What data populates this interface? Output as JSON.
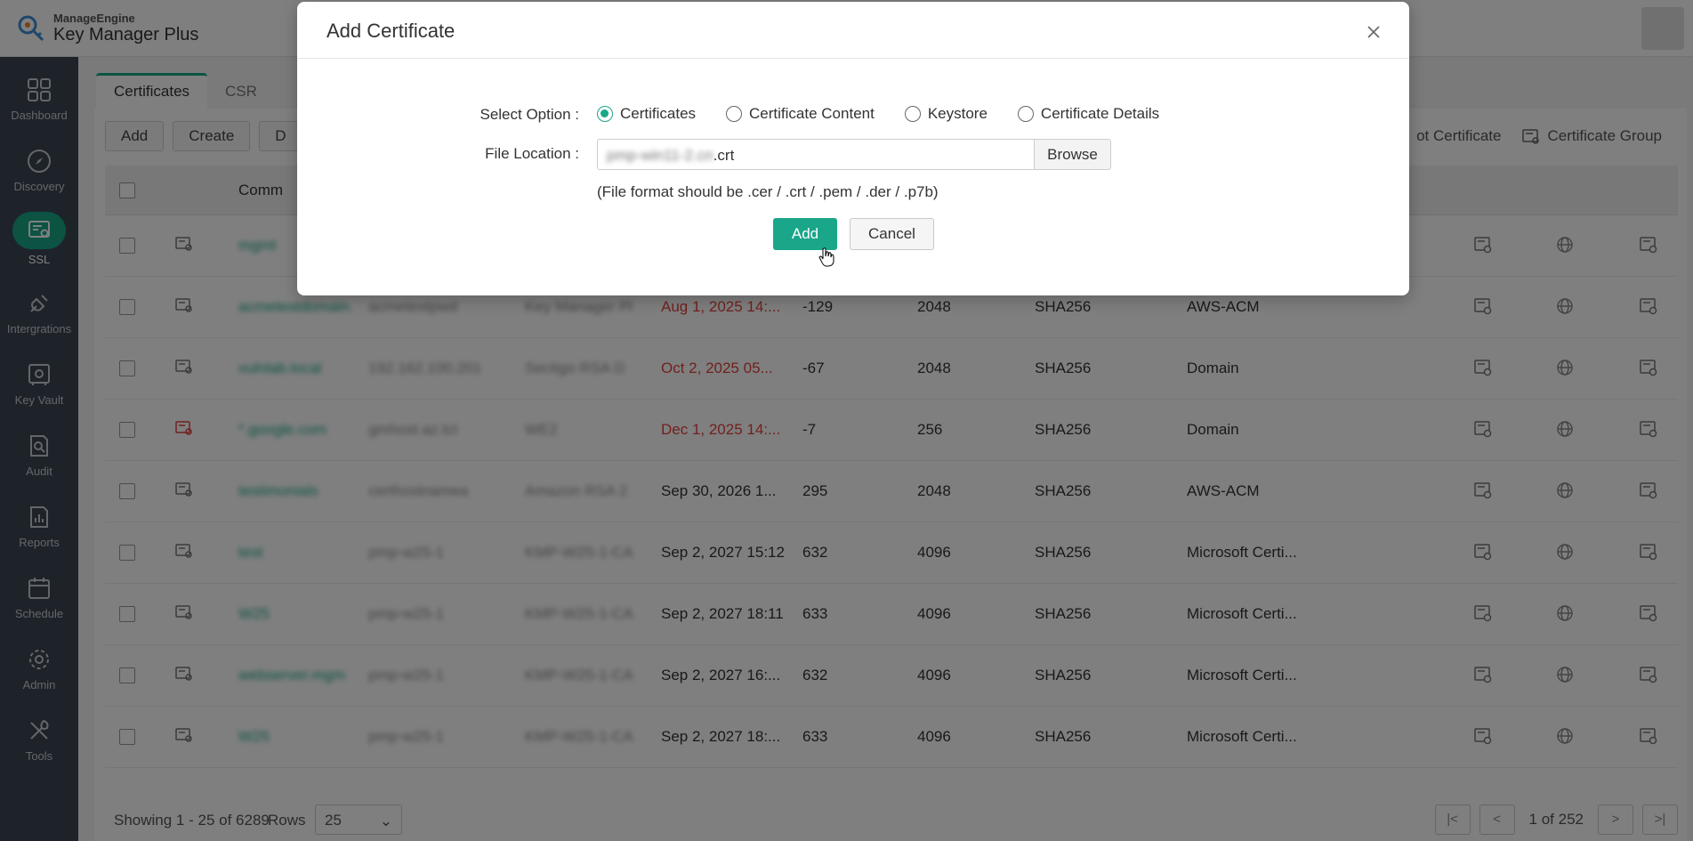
{
  "header": {
    "brand": "ManageEngine",
    "product": "Key Manager Plus"
  },
  "sidebar": {
    "items": [
      {
        "label": "Dashboard",
        "icon": "dashboard-icon"
      },
      {
        "label": "Discovery",
        "icon": "compass-icon"
      },
      {
        "label": "SSL",
        "icon": "certificate-icon",
        "active": true
      },
      {
        "label": "Intergrations",
        "icon": "plug-icon"
      },
      {
        "label": "Key Vault",
        "icon": "vault-icon"
      },
      {
        "label": "Audit",
        "icon": "audit-icon"
      },
      {
        "label": "Reports",
        "icon": "reports-icon"
      },
      {
        "label": "Schedule",
        "icon": "calendar-icon"
      },
      {
        "label": "Admin",
        "icon": "gear-icon"
      },
      {
        "label": "Tools",
        "icon": "tools-icon"
      }
    ]
  },
  "tabs": [
    "Certificates",
    "CSR"
  ],
  "toolbar": {
    "add": "Add",
    "create": "Create",
    "partial": "D",
    "root_certificate": "ot Certificate",
    "certificate_group": "Certificate Group"
  },
  "table": {
    "header_partial": "Comm",
    "rows": [
      {
        "name": "mgmt",
        "dns": "",
        "issuer": "",
        "expiry": "",
        "days": "",
        "key": "",
        "algo": "",
        "type": "",
        "expired": false
      },
      {
        "name": "acmetestdomain.",
        "dns": "acmetestpwd",
        "issuer": "Key Manager Pl",
        "expiry": "Aug 1, 2025 14:...",
        "days": "-129",
        "key": "2048",
        "algo": "SHA256",
        "type": "AWS-ACM",
        "expired": true
      },
      {
        "name": "vulnlab.local",
        "dns": "192.162.100.201",
        "issuer": "Sectigo RSA D",
        "expiry": "Oct 2, 2025 05...",
        "days": "-67",
        "key": "2048",
        "algo": "SHA256",
        "type": "Domain",
        "expired": true
      },
      {
        "name": "*.google.com",
        "dns": "gmhost.az.tcl",
        "issuer": "WE2",
        "expiry": "Dec 1, 2025 14:...",
        "days": "-7",
        "key": "256",
        "algo": "SHA256",
        "type": "Domain",
        "expired": true
      },
      {
        "name": "testimonials",
        "dns": "certhostnamea",
        "issuer": "Amazon RSA 2",
        "expiry": "Sep 30, 2026 1...",
        "days": "295",
        "key": "2048",
        "algo": "SHA256",
        "type": "AWS-ACM",
        "expired": false
      },
      {
        "name": "test",
        "dns": "pmp-w25-1",
        "issuer": "KMP-W25-1-CA",
        "expiry": "Sep 2, 2027 15:12",
        "days": "632",
        "key": "4096",
        "algo": "SHA256",
        "type": "Microsoft Certi...",
        "expired": false
      },
      {
        "name": "W25",
        "dns": "pmp-w25-1",
        "issuer": "KMP-W25-1-CA",
        "expiry": "Sep 2, 2027 18:11",
        "days": "633",
        "key": "4096",
        "algo": "SHA256",
        "type": "Microsoft Certi...",
        "expired": false
      },
      {
        "name": "webserver.mgm",
        "dns": "pmp-w25-1",
        "issuer": "KMP-W25-1-CA",
        "expiry": "Sep 2, 2027 16:...",
        "days": "632",
        "key": "4096",
        "algo": "SHA256",
        "type": "Microsoft Certi...",
        "expired": false
      },
      {
        "name": "W25",
        "dns": "pmp-w25-1",
        "issuer": "KMP-W25-1-CA",
        "expiry": "Sep 2, 2027 18:...",
        "days": "633",
        "key": "4096",
        "algo": "SHA256",
        "type": "Microsoft Certi...",
        "expired": false
      }
    ]
  },
  "footer": {
    "showing": "Showing 1 - 25 of 6289",
    "rows_label": "Rows",
    "rows_value": "25",
    "page_info": "1 of 252"
  },
  "modal": {
    "title": "Add Certificate",
    "select_option_label": "Select Option :",
    "options": [
      "Certificates",
      "Certificate Content",
      "Keystore",
      "Certificate Details"
    ],
    "selected_option": "Certificates",
    "file_location_label": "File Location :",
    "file_value_blurred": "pmp-win11-2.cn",
    "file_value_ext": ".crt",
    "browse": "Browse",
    "hint": "(File format should be .cer / .crt / .pem / .der / .p7b)",
    "add": "Add",
    "cancel": "Cancel"
  },
  "colors": {
    "accent": "#19a689",
    "sidebar": "#3c4654",
    "expired": "#e0423c"
  }
}
